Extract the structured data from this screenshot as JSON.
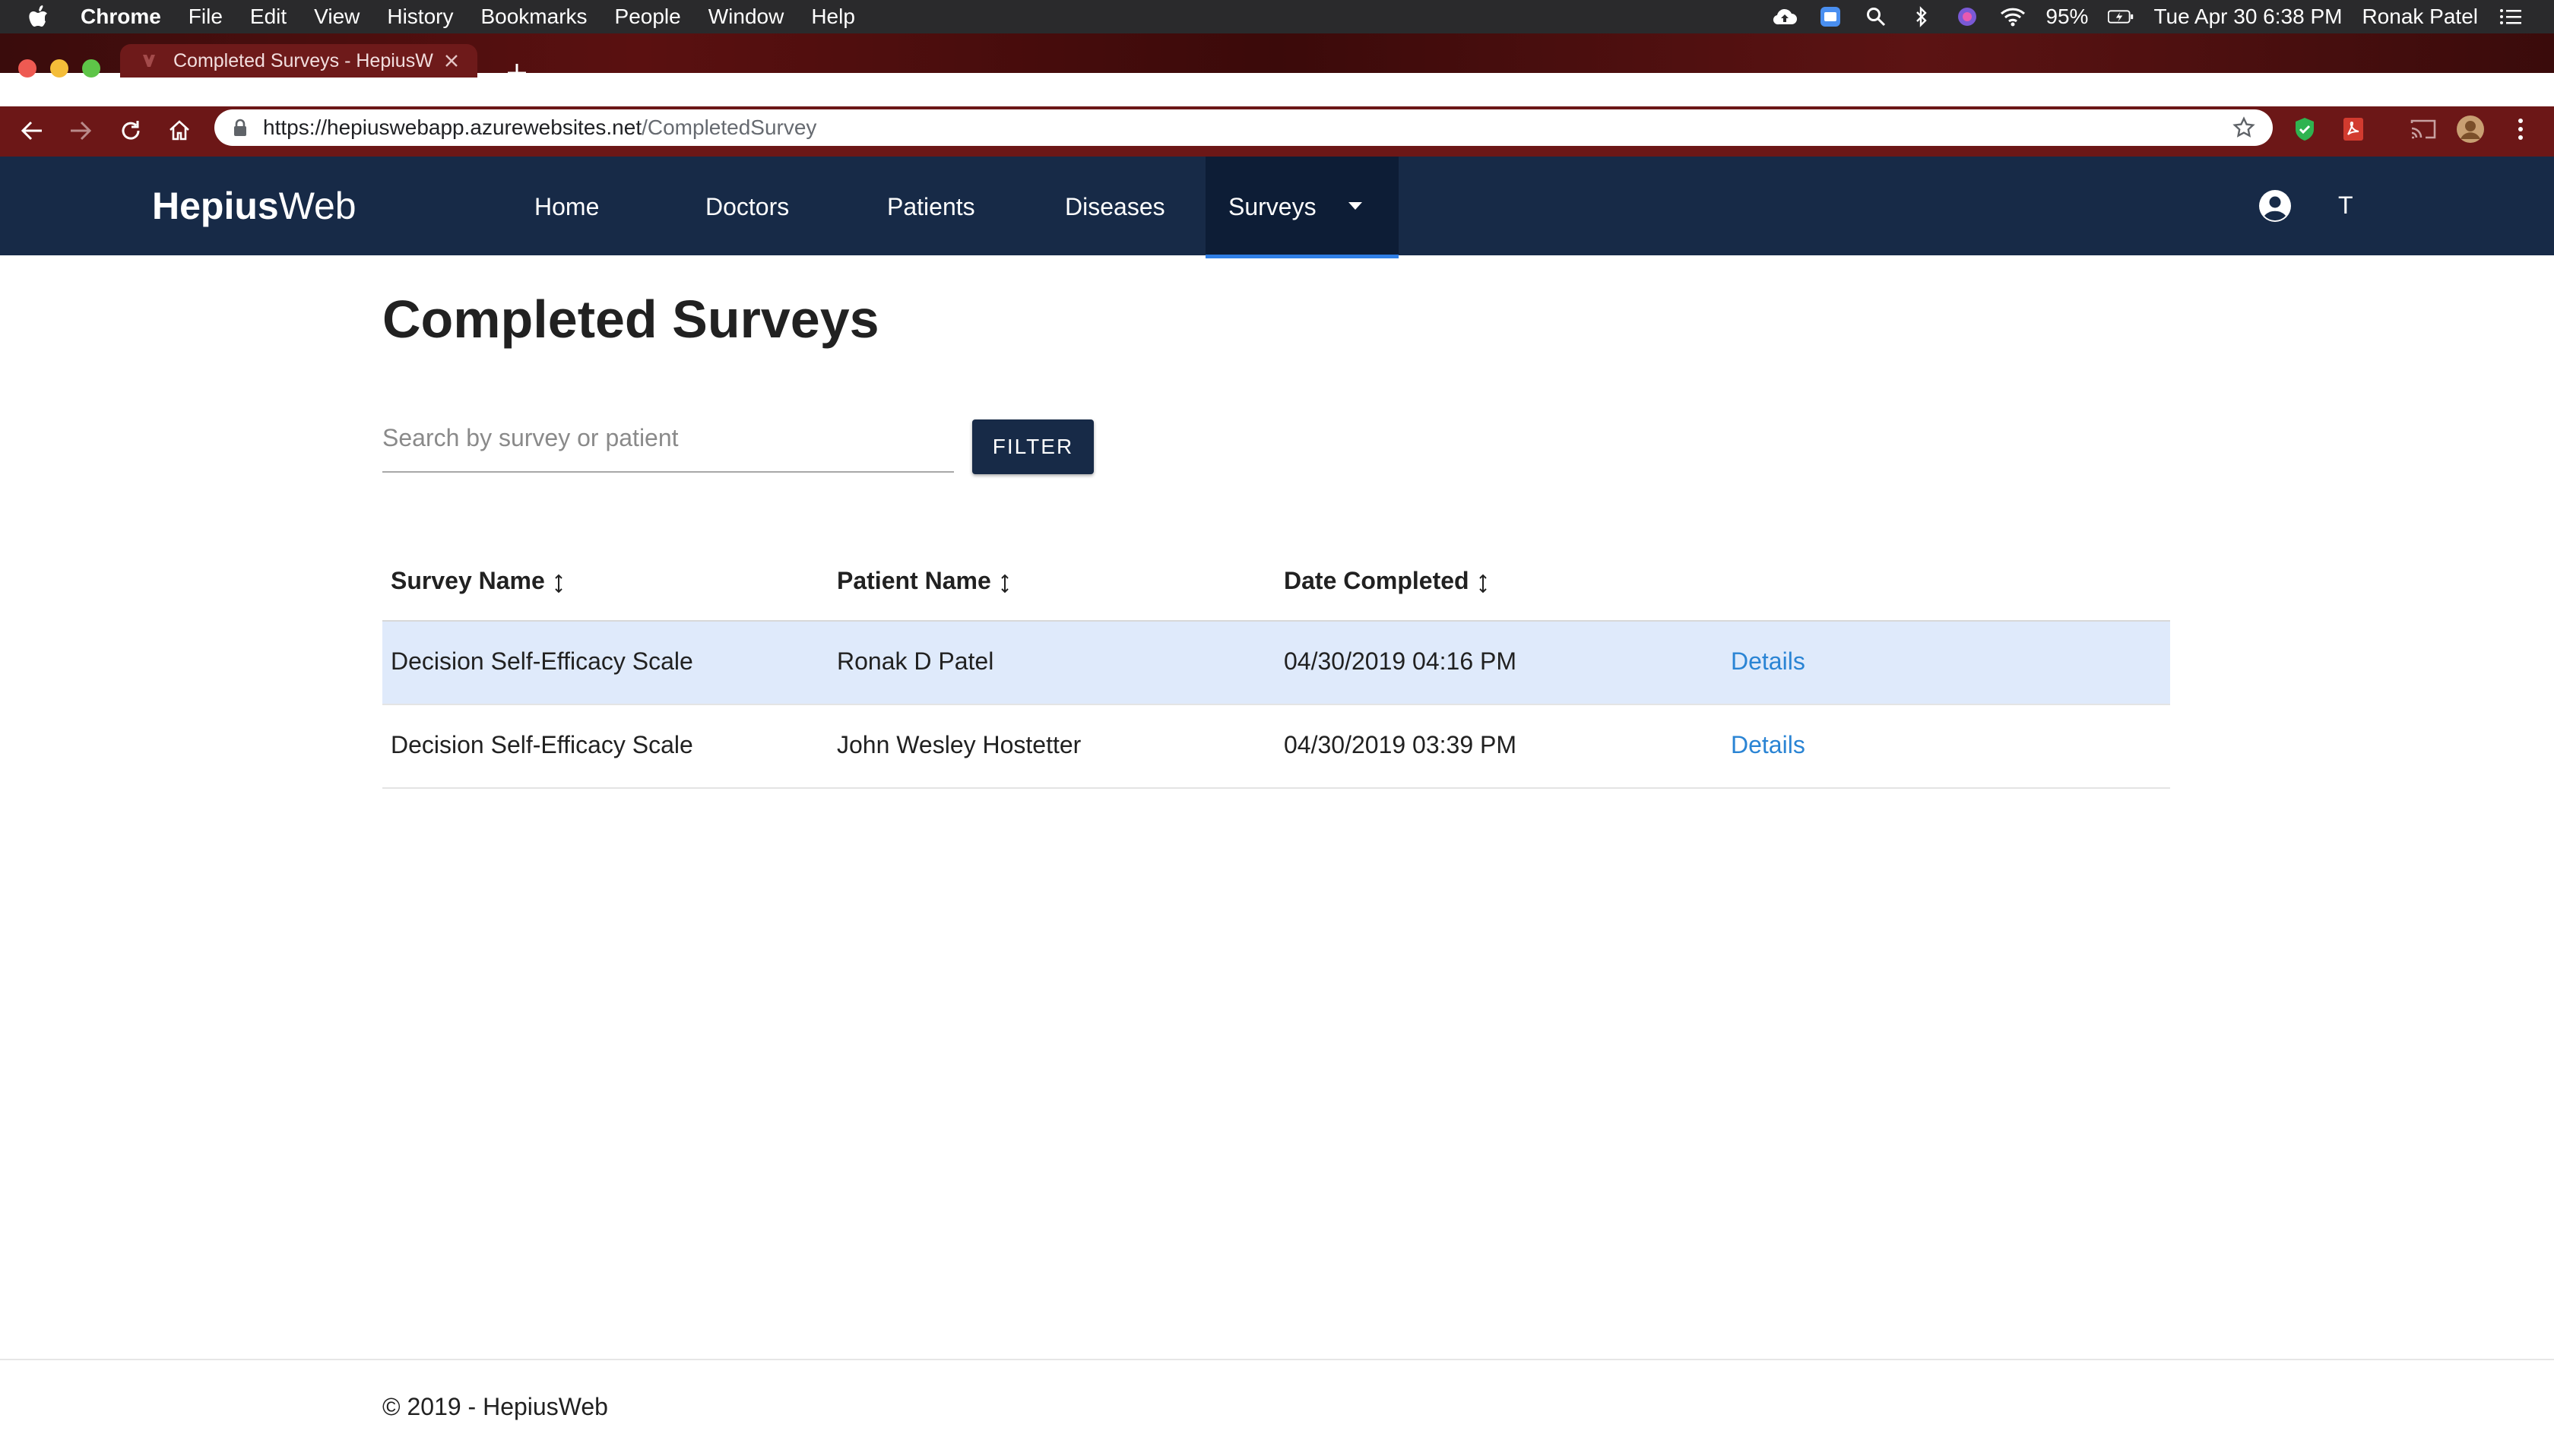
{
  "menubar": {
    "app_name": "Chrome",
    "items": [
      "File",
      "Edit",
      "View",
      "History",
      "Bookmarks",
      "People",
      "Window",
      "Help"
    ],
    "battery": "95%",
    "datetime": "Tue Apr 30  6:38 PM",
    "user": "Ronak Patel"
  },
  "browser": {
    "tab_title": "Completed Surveys - HepiusW",
    "url_host": "https://hepiuswebapp.azurewebsites.net",
    "url_path": "/CompletedSurvey"
  },
  "appnav": {
    "brand_bold": "Hepius",
    "brand_light": "Web",
    "links": [
      "Home",
      "Doctors",
      "Patients",
      "Diseases"
    ],
    "active_link": "Surveys",
    "account_initial": "T"
  },
  "page": {
    "title": "Completed Surveys",
    "search_placeholder": "Search by survey or patient",
    "search_value": "",
    "filter_label": "FILTER"
  },
  "table": {
    "columns": [
      "Survey Name",
      "Patient Name",
      "Date Completed"
    ],
    "rows": [
      {
        "survey": "Decision Self-Efficacy Scale",
        "patient": "Ronak D Patel",
        "date": "04/30/2019 04:16 PM",
        "action": "Details",
        "selected": true
      },
      {
        "survey": "Decision Self-Efficacy Scale",
        "patient": "John Wesley Hostetter",
        "date": "04/30/2019 03:39 PM",
        "action": "Details",
        "selected": false
      }
    ]
  },
  "footer": {
    "text": "© 2019 - HepiusWeb"
  },
  "colors": {
    "navbar": "#172a47",
    "active_underline": "#2f7fe6",
    "link": "#2a84d4",
    "selected_row": "#dfeafb"
  }
}
